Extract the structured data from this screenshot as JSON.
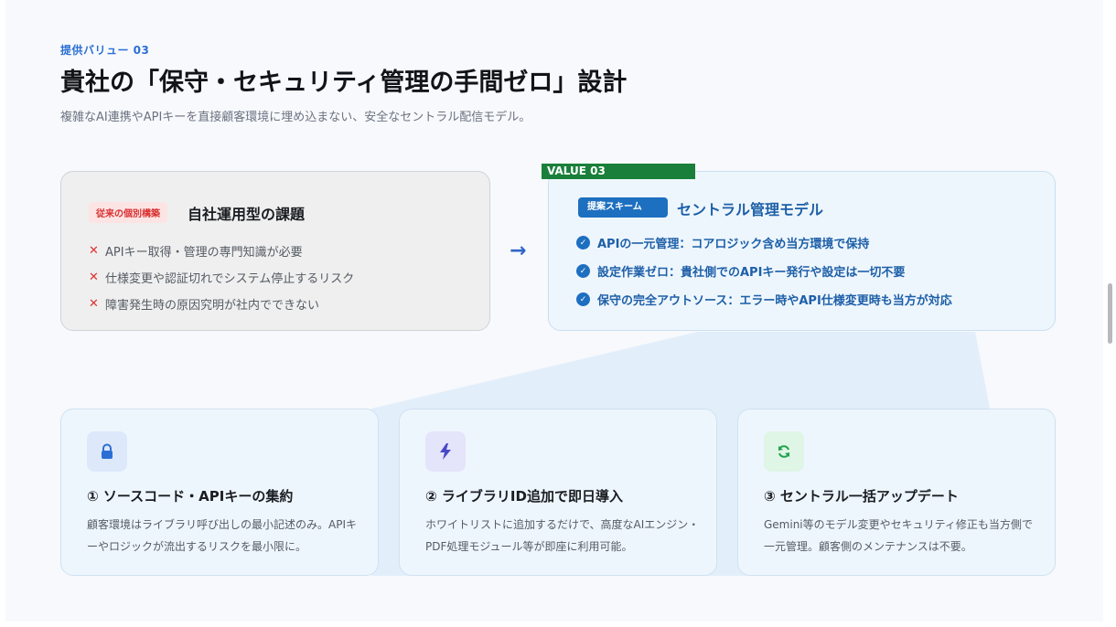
{
  "header": {
    "eyebrow": "提供バリュー 03",
    "title": "貴社の「保守・セキュリティ管理の手間ゼロ」設計",
    "subtitle": "複雑なAI連携やAPIキーを直接顧客環境に埋め込まない、安全なセントラル配信モデル。"
  },
  "legacy": {
    "tag": "従来の個別構築",
    "title": "自社運用型の課題",
    "icon": "x-mark-icon",
    "items": [
      "APIキー取得・管理の専門知識が必要",
      "仕様変更や認証切れでシステム停止するリスク",
      "障害発生時の原因究明が社内でできない"
    ]
  },
  "arrow": {
    "icon": "arrow-right-icon",
    "glyph": "→"
  },
  "central": {
    "badge": "VALUE 03",
    "tag": "提案スキーム",
    "title": "セントラル管理モデル",
    "icon": "check-circle-icon",
    "items": [
      "APIの一元管理：コアロジック含め当方環境で保持",
      "設定作業ゼロ：貴社側でのAPIキー発行や設定は一切不要",
      "保守の完全アウトソース：エラー時やAPI仕様変更時も当方が対応"
    ]
  },
  "features": [
    {
      "icon": "lock-icon",
      "title": "① ソースコード・APIキーの集約",
      "desc": "顧客環境はライブラリ呼び出しの最小記述のみ。APIキーやロジックが流出するリスクを最小限に。"
    },
    {
      "icon": "lightning-icon",
      "title": "② ライブラリID追加で即日導入",
      "desc": "ホワイトリストに追加するだけで、高度なAIエンジン・PDF処理モジュール等が即座に利用可能。"
    },
    {
      "icon": "refresh-icon",
      "title": "③ セントラル一括アップデート",
      "desc": "Gemini等のモデル変更やセキュリティ修正も当方側で一元管理。顧客側のメンテナンスは不要。"
    }
  ],
  "colors": {
    "accent_blue": "#1d6fc0",
    "value_green": "#1a7f3a",
    "danger_red": "#e03131",
    "background": "#f7f9fc"
  }
}
